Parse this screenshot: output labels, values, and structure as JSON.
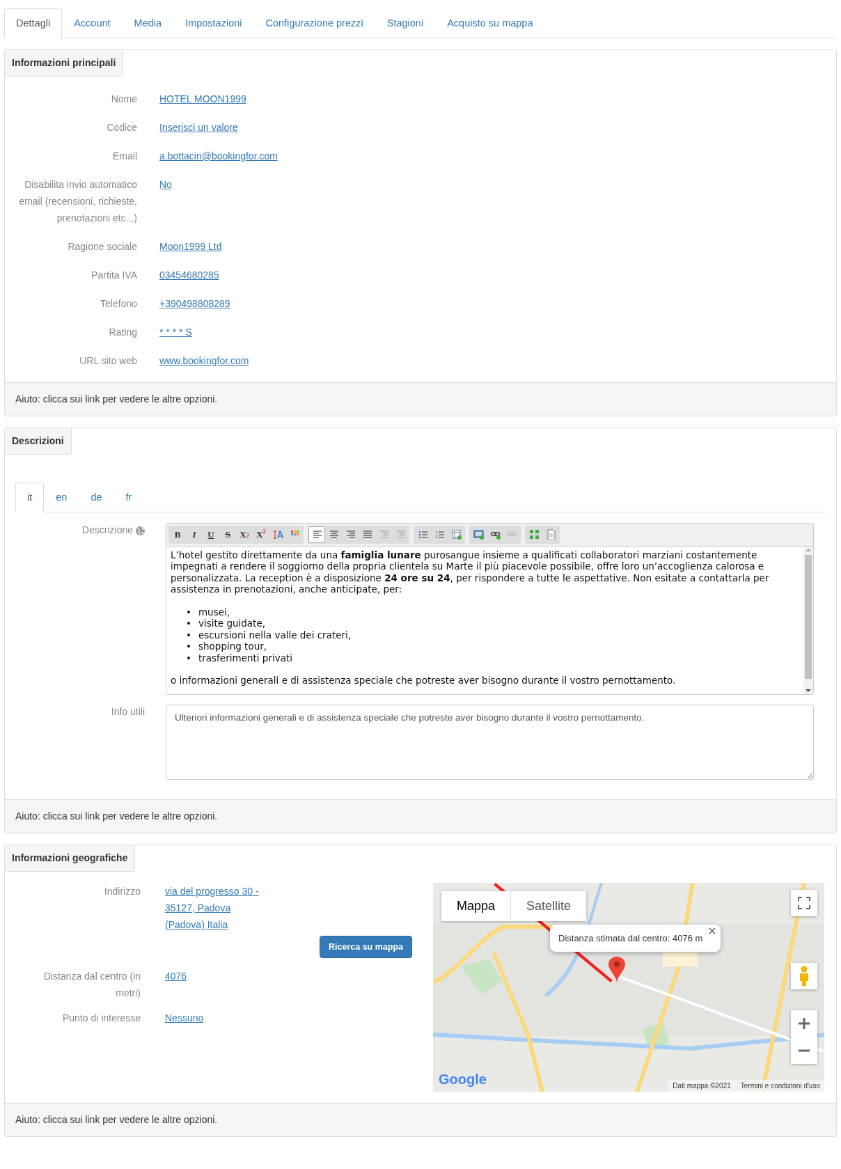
{
  "tabs": [
    {
      "label": "Dettagli",
      "selected": true
    },
    {
      "label": "Account",
      "selected": false
    },
    {
      "label": "Media",
      "selected": false
    },
    {
      "label": "Impostazioni",
      "selected": false
    },
    {
      "label": "Configurazione prezzi",
      "selected": false
    },
    {
      "label": "Stagioni",
      "selected": false
    },
    {
      "label": "Acquisto su mappa",
      "selected": false
    }
  ],
  "main_info": {
    "title": "Informazioni principali",
    "fields": [
      {
        "label": "Nome",
        "value": "HOTEL MOON1999"
      },
      {
        "label": "Codice",
        "value": "Inserisci un valore"
      },
      {
        "label": "Email",
        "value": "a.bottacin@bookingfor.com"
      },
      {
        "label": "Disabilita invio automatico email (recensioni, richieste, prenotazioni etc...)",
        "value": "No"
      },
      {
        "label": "Ragione sociale",
        "value": "Moon1999 Ltd"
      },
      {
        "label": "Partita IVA",
        "value": "03454680285"
      },
      {
        "label": "Telefono",
        "value": "+390498808289"
      },
      {
        "label": "Rating",
        "value": "* * * * S"
      },
      {
        "label": "URL sito web",
        "value": "www.bookingfor.com"
      }
    ],
    "help": "Aiuto: clicca sui link per vedere le altre opzioni."
  },
  "descriptions": {
    "title": "Descrizioni",
    "lang_tabs": [
      {
        "label": "it",
        "selected": true
      },
      {
        "label": "en",
        "selected": false
      },
      {
        "label": "de",
        "selected": false
      },
      {
        "label": "fr",
        "selected": false
      }
    ],
    "description_label": "Descrizione",
    "toolbar": [
      [
        {
          "kind": "text",
          "label": "B",
          "selected": false
        },
        {
          "kind": "text",
          "label": "I",
          "selected": false
        },
        {
          "kind": "text",
          "label": "U",
          "selected": false
        },
        {
          "kind": "text",
          "label": "S",
          "selected": false
        },
        {
          "kind": "text",
          "label": "X$_{2}$",
          "selected": false
        },
        {
          "kind": "text",
          "label": "X$^{2}$",
          "selected": false
        },
        {
          "kind": "icon",
          "selected": false
        },
        {
          "kind": "icon",
          "selected": false
        }
      ],
      [
        {
          "kind": "icon",
          "selected": true
        },
        {
          "kind": "icon",
          "selected": false
        },
        {
          "kind": "icon",
          "selected": false
        },
        {
          "kind": "icon",
          "selected": false
        },
        {
          "kind": "icon",
          "disabled": true,
          "selected": false
        },
        {
          "kind": "icon",
          "disabled": true,
          "selected": false
        }
      ],
      [
        {
          "kind": "icon",
          "selected": false
        },
        {
          "kind": "icon",
          "selected": false
        },
        {
          "kind": "icon",
          "selected": false
        }
      ],
      [
        {
          "kind": "icon",
          "selected": false
        },
        {
          "kind": "icon",
          "selected": false
        },
        {
          "kind": "icon",
          "disabled": true,
          "selected": false
        }
      ],
      [
        {
          "kind": "icon",
          "selected": false
        },
        {
          "kind": "icon",
          "selected": false
        }
      ]
    ],
    "editor": {
      "intro": "L’hotel gestito direttamente da una **famiglia lunare** purosangue insieme a qualificati collaboratori marziani costantemente impegnati a rendere il soggiorno della propria clientela su Marte il più piacevole possibile, offre loro un’accoglienza calorosa e personalizzata. La reception è a disposizione **24 ore su 24**, per rispondere a tutte le aspettative. Non esitate a contattarla per assistenza in prenotazioni, anche anticipate, per:",
      "list": [
        {
          "marker": "•",
          "text": "musei,"
        },
        {
          "marker": "•",
          "text": "visite guidate,"
        },
        {
          "marker": "•",
          "text": "escursioni nella valle dei crateri,"
        },
        {
          "marker": "•",
          "text": "shopping tour,"
        },
        {
          "marker": "•",
          "text": "trasferimenti privati"
        }
      ],
      "outro": "o informazioni generali e di assistenza speciale che potreste aver bisogno durante il vostro pernottamento."
    },
    "info_label": "Info utili",
    "info_value": "Ulteriori informazioni generali e di assistenza speciale che potreste aver bisogno durante il vostro pernottamento.",
    "help": "Aiuto: clicca sui link per vedere le altre opzioni."
  },
  "geo": {
    "title": "Informazioni geografiche",
    "fields": [
      {
        "label": "Indirizzo",
        "value": "via del progresso 30 - 35127, Padova (Padova) Italia"
      },
      {
        "label": "Distanza dal centro (in metri)",
        "value": "4076"
      },
      {
        "label": "Punto di interesse",
        "value": "Nessuno"
      }
    ],
    "search_button": "Ricerca su mappa",
    "map": {
      "types": [
        {
          "label": "Mappa",
          "selected": true
        },
        {
          "label": "Satellite",
          "selected": false
        }
      ],
      "info_window": "Distanza stimata dal centro: 4076 m",
      "logo": "Google",
      "data_credit": "Dati mappa ©2021",
      "terms": "Termini e condizioni d'uso"
    },
    "help": "Aiuto: clicca sui link per vedere le altre opzioni."
  }
}
